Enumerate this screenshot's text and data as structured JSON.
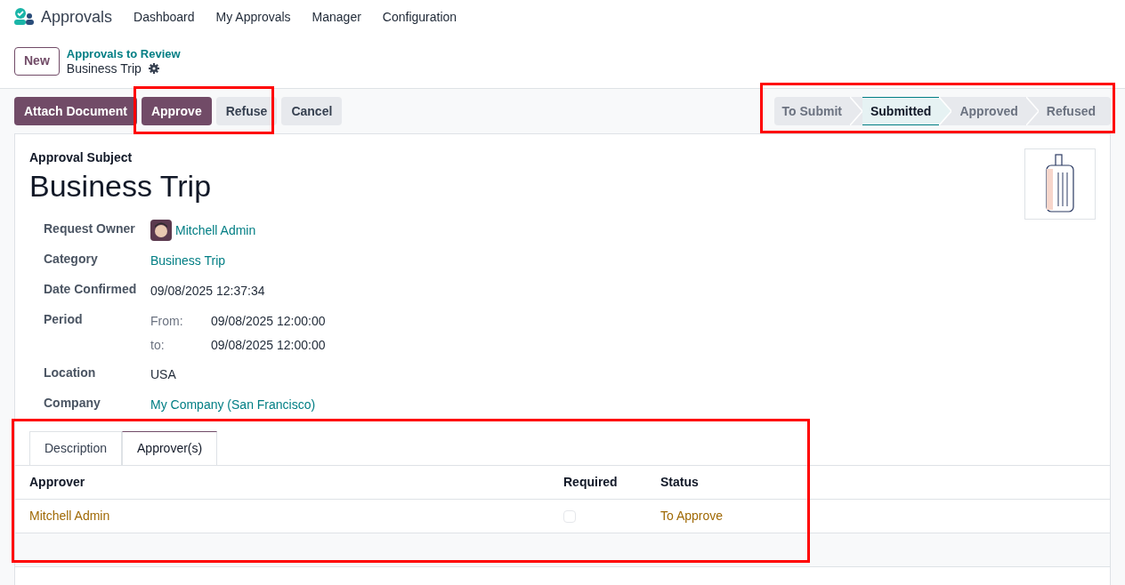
{
  "app": {
    "name": "Approvals",
    "menu": [
      "Dashboard",
      "My Approvals",
      "Manager",
      "Configuration"
    ]
  },
  "breadcrumb": {
    "new_button": "New",
    "parent": "Approvals to Review",
    "current": "Business Trip"
  },
  "actions": [
    {
      "label": "Attach Document",
      "kind": "primary"
    },
    {
      "label": "Approve",
      "kind": "primary"
    },
    {
      "label": "Refuse",
      "kind": "secondary"
    },
    {
      "label": "Cancel",
      "kind": "secondary"
    }
  ],
  "stages": [
    {
      "label": "To Submit",
      "selected": false
    },
    {
      "label": "Submitted",
      "selected": true
    },
    {
      "label": "Approved",
      "selected": false
    },
    {
      "label": "Refused",
      "selected": false
    }
  ],
  "form": {
    "subject_label": "Approval Subject",
    "subject": "Business Trip",
    "fields": [
      {
        "label": "Request Owner",
        "kind": "user",
        "value": "Mitchell Admin"
      },
      {
        "label": "Category",
        "kind": "link",
        "value": "Business Trip"
      },
      {
        "label": "Date Confirmed",
        "kind": "text",
        "value": "09/08/2025 12:37:34"
      },
      {
        "label": "Period",
        "kind": "range",
        "from_label": "From:",
        "from": "09/08/2025 12:00:00",
        "to_label": "to:",
        "to": "09/08/2025 12:00:00"
      },
      {
        "label": "Location",
        "kind": "text",
        "value": "USA"
      },
      {
        "label": "Company",
        "kind": "link",
        "value": "My Company (San Francisco)"
      }
    ]
  },
  "tabs": [
    {
      "label": "Description",
      "selected": false
    },
    {
      "label": "Approver(s)",
      "selected": true
    }
  ],
  "table": {
    "columns": [
      "Approver",
      "Required",
      "Status"
    ],
    "rows": [
      {
        "approver": "Mitchell Admin",
        "required": false,
        "status": "To Approve"
      }
    ]
  }
}
